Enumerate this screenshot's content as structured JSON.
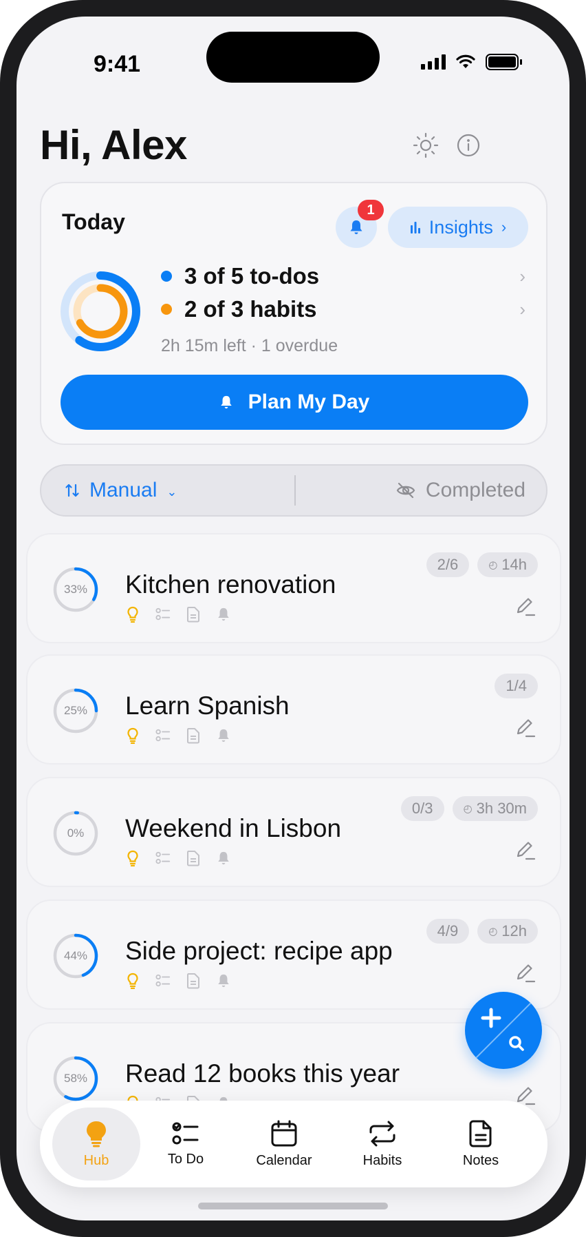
{
  "status_bar": {
    "time": "9:41"
  },
  "header": {
    "greeting": "Hi, Alex"
  },
  "today": {
    "title": "Today",
    "notification_count": "1",
    "insights_label": "Insights",
    "todos_text": "3 of 5 to-dos",
    "habits_text": "2 of 3 habits",
    "summary": "2h 15m left · 1 overdue",
    "todos_progress": 0.6,
    "habits_progress": 0.667,
    "plan_button": "Plan My Day"
  },
  "filter": {
    "sort_label": "Manual",
    "completed_label": "Completed"
  },
  "projects": [
    {
      "title": "Kitchen renovation",
      "percent_label": "33%",
      "progress": 0.33,
      "count": "2/6",
      "time": "14h"
    },
    {
      "title": "Learn Spanish",
      "percent_label": "25%",
      "progress": 0.25,
      "count": "1/4",
      "time": ""
    },
    {
      "title": "Weekend in Lisbon",
      "percent_label": "0%",
      "progress": 0.0,
      "count": "0/3",
      "time": "3h 30m"
    },
    {
      "title": "Side project: recipe app",
      "percent_label": "44%",
      "progress": 0.44,
      "count": "4/9",
      "time": "12h"
    },
    {
      "title": "Read 12 books this year",
      "percent_label": "58%",
      "progress": 0.58,
      "count": "",
      "time": ""
    }
  ],
  "tabs": [
    {
      "label": "Hub",
      "icon": "bulb-icon",
      "active": true
    },
    {
      "label": "To Do",
      "icon": "checklist-icon",
      "active": false
    },
    {
      "label": "Calendar",
      "icon": "calendar-icon",
      "active": false
    },
    {
      "label": "Habits",
      "icon": "repeat-icon",
      "active": false
    },
    {
      "label": "Notes",
      "icon": "note-icon",
      "active": false
    }
  ],
  "colors": {
    "accent": "#0a7ef5",
    "habit": "#f7960e",
    "hub": "#f3a212",
    "badge": "#f0363b"
  }
}
